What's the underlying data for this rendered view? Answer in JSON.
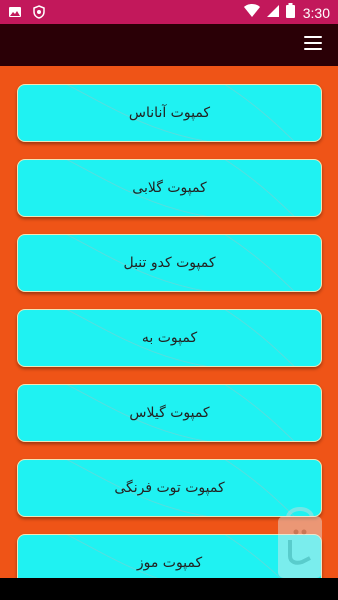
{
  "status_bar": {
    "time": "3:30",
    "left_icons": [
      "image-icon",
      "shield-icon"
    ],
    "right_icons": [
      "wifi-icon",
      "signal-icon",
      "battery-icon"
    ]
  },
  "toolbar": {
    "menu_icon": "hamburger-menu-icon"
  },
  "items": [
    {
      "label": "کمپوت آناناس"
    },
    {
      "label": "کمپوت گلابی"
    },
    {
      "label": "کمپوت کدو تنبل"
    },
    {
      "label": "کمپوت به"
    },
    {
      "label": "کمپوت گیلاس"
    },
    {
      "label": "کمپوت توت فرنگی"
    },
    {
      "label": "کمپوت موز"
    }
  ],
  "colors": {
    "background": "#ef5417",
    "toolbar": "#2a0006",
    "status_bar": "#c2185b",
    "item": "#1ff2f2"
  }
}
